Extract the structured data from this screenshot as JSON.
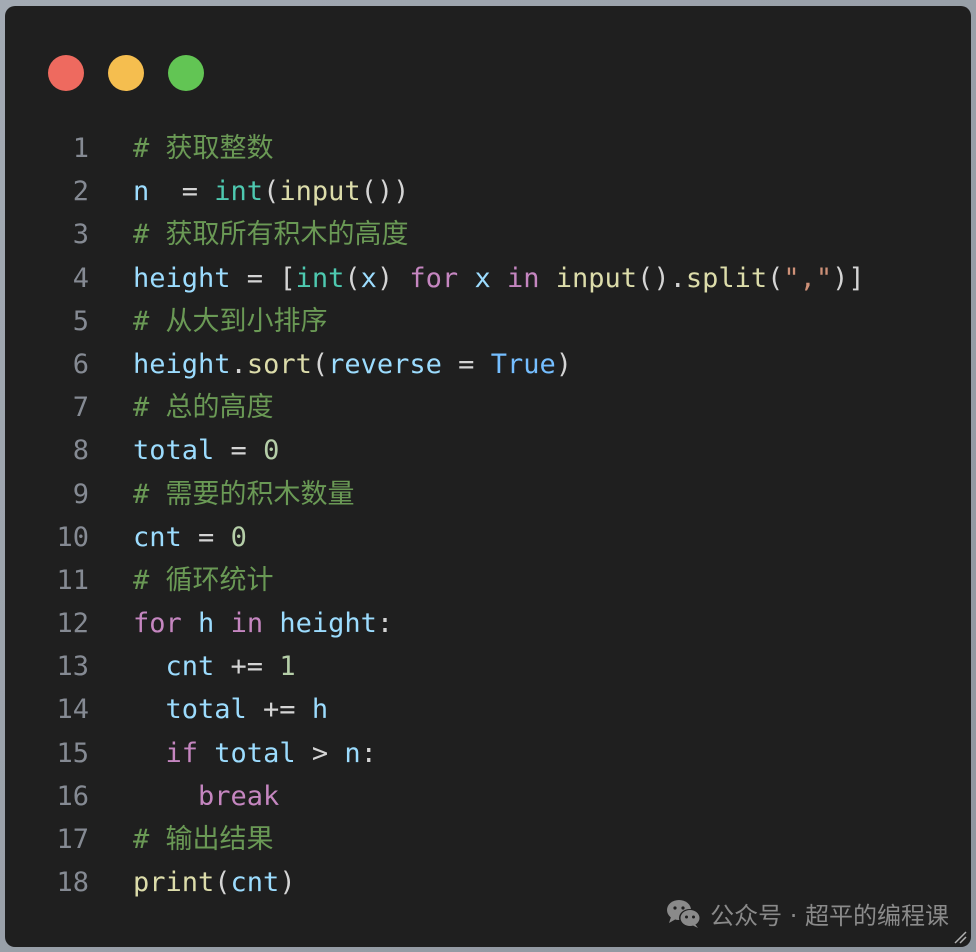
{
  "window": {
    "controls": [
      {
        "name": "close",
        "color": "#ee6a5f"
      },
      {
        "name": "minimize",
        "color": "#f5be4f"
      },
      {
        "name": "maximize",
        "color": "#62c554"
      }
    ]
  },
  "code": {
    "language": "python",
    "lines": [
      {
        "num": "1",
        "tokens": [
          {
            "t": "comment",
            "v": "# 获取整数"
          }
        ]
      },
      {
        "num": "2",
        "tokens": [
          {
            "t": "var",
            "v": "n"
          },
          {
            "t": "op",
            "v": "  = "
          },
          {
            "t": "builtin",
            "v": "int"
          },
          {
            "t": "punct",
            "v": "("
          },
          {
            "t": "func",
            "v": "input"
          },
          {
            "t": "punct",
            "v": "())"
          }
        ]
      },
      {
        "num": "3",
        "tokens": [
          {
            "t": "comment",
            "v": "# 获取所有积木的高度"
          }
        ]
      },
      {
        "num": "4",
        "tokens": [
          {
            "t": "var",
            "v": "height"
          },
          {
            "t": "op",
            "v": " = "
          },
          {
            "t": "punct",
            "v": "["
          },
          {
            "t": "builtin",
            "v": "int"
          },
          {
            "t": "punct",
            "v": "("
          },
          {
            "t": "var",
            "v": "x"
          },
          {
            "t": "punct",
            "v": ") "
          },
          {
            "t": "kw",
            "v": "for"
          },
          {
            "t": "op",
            "v": " "
          },
          {
            "t": "var",
            "v": "x"
          },
          {
            "t": "op",
            "v": " "
          },
          {
            "t": "kw",
            "v": "in"
          },
          {
            "t": "op",
            "v": " "
          },
          {
            "t": "func",
            "v": "input"
          },
          {
            "t": "punct",
            "v": "()."
          },
          {
            "t": "func",
            "v": "split"
          },
          {
            "t": "punct",
            "v": "("
          },
          {
            "t": "str",
            "v": "\",\""
          },
          {
            "t": "punct",
            "v": ")]"
          }
        ]
      },
      {
        "num": "5",
        "tokens": [
          {
            "t": "comment",
            "v": "# 从大到小排序"
          }
        ]
      },
      {
        "num": "6",
        "tokens": [
          {
            "t": "var",
            "v": "height"
          },
          {
            "t": "punct",
            "v": "."
          },
          {
            "t": "func",
            "v": "sort"
          },
          {
            "t": "punct",
            "v": "("
          },
          {
            "t": "var",
            "v": "reverse"
          },
          {
            "t": "op",
            "v": " = "
          },
          {
            "t": "const",
            "v": "True"
          },
          {
            "t": "punct",
            "v": ")"
          }
        ]
      },
      {
        "num": "7",
        "tokens": [
          {
            "t": "comment",
            "v": "# 总的高度"
          }
        ]
      },
      {
        "num": "8",
        "tokens": [
          {
            "t": "var",
            "v": "total"
          },
          {
            "t": "op",
            "v": " = "
          },
          {
            "t": "num",
            "v": "0"
          }
        ]
      },
      {
        "num": "9",
        "tokens": [
          {
            "t": "comment",
            "v": "# 需要的积木数量"
          }
        ]
      },
      {
        "num": "10",
        "tokens": [
          {
            "t": "var",
            "v": "cnt"
          },
          {
            "t": "op",
            "v": " = "
          },
          {
            "t": "num",
            "v": "0"
          }
        ]
      },
      {
        "num": "11",
        "tokens": [
          {
            "t": "comment",
            "v": "# 循环统计"
          }
        ]
      },
      {
        "num": "12",
        "tokens": [
          {
            "t": "kw",
            "v": "for"
          },
          {
            "t": "op",
            "v": " "
          },
          {
            "t": "var",
            "v": "h"
          },
          {
            "t": "op",
            "v": " "
          },
          {
            "t": "kw",
            "v": "in"
          },
          {
            "t": "op",
            "v": " "
          },
          {
            "t": "var",
            "v": "height"
          },
          {
            "t": "punct",
            "v": ":"
          }
        ]
      },
      {
        "num": "13",
        "tokens": [
          {
            "t": "op",
            "v": "  "
          },
          {
            "t": "var",
            "v": "cnt"
          },
          {
            "t": "op",
            "v": " += "
          },
          {
            "t": "num",
            "v": "1"
          }
        ]
      },
      {
        "num": "14",
        "tokens": [
          {
            "t": "op",
            "v": "  "
          },
          {
            "t": "var",
            "v": "total"
          },
          {
            "t": "op",
            "v": " += "
          },
          {
            "t": "var",
            "v": "h"
          }
        ]
      },
      {
        "num": "15",
        "tokens": [
          {
            "t": "op",
            "v": "  "
          },
          {
            "t": "kw",
            "v": "if"
          },
          {
            "t": "op",
            "v": " "
          },
          {
            "t": "var",
            "v": "total"
          },
          {
            "t": "op",
            "v": " > "
          },
          {
            "t": "var",
            "v": "n"
          },
          {
            "t": "punct",
            "v": ":"
          }
        ]
      },
      {
        "num": "16",
        "tokens": [
          {
            "t": "op",
            "v": "    "
          },
          {
            "t": "kw",
            "v": "break"
          }
        ]
      },
      {
        "num": "17",
        "tokens": [
          {
            "t": "comment",
            "v": "# 输出结果"
          }
        ]
      },
      {
        "num": "18",
        "tokens": [
          {
            "t": "func",
            "v": "print"
          },
          {
            "t": "punct",
            "v": "("
          },
          {
            "t": "var",
            "v": "cnt"
          },
          {
            "t": "punct",
            "v": ")"
          }
        ]
      }
    ]
  },
  "watermark": {
    "icon": "wechat-icon",
    "text": "公众号 · 超平的编程课"
  }
}
